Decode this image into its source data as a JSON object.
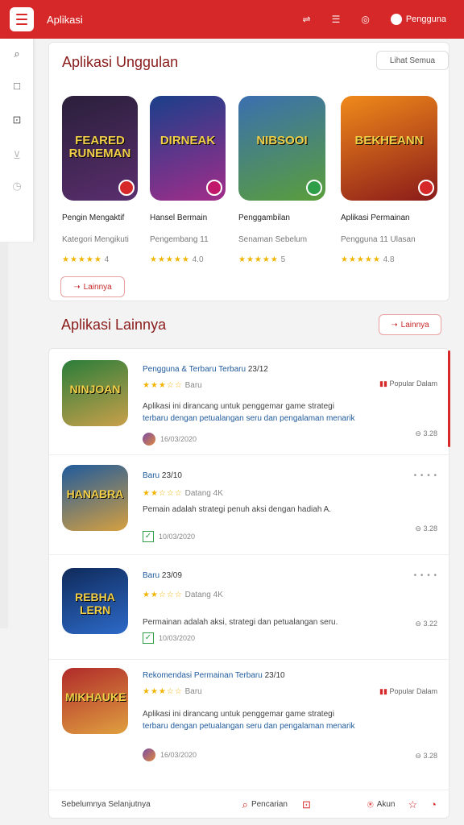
{
  "app": {
    "title": "Aplikasi"
  },
  "topbar": {
    "profile_label": "Pengguna"
  },
  "featured": {
    "title": "Aplikasi Unggulan",
    "header_button": "Lihat Semua",
    "footer_button": "Lainnya",
    "items": [
      {
        "thumb_title": "FEARED RUNEMAN",
        "name": "Pengin Mengaktif",
        "sub": "Kategori Mengikuti",
        "rating": "4",
        "grad": "#2a1f3a,#5a2e6e"
      },
      {
        "thumb_title": "DIRNEAK",
        "name": "Hansel Bermain",
        "sub": "Pengembang 11",
        "rating": "4.0",
        "grad": "#1a3f8a,#a22d8a"
      },
      {
        "thumb_title": "NIBSOOI",
        "name": "Penggambilan",
        "sub": "Senaman Sebelum",
        "rating": "5",
        "grad": "#3a6fb0,#c9a04a"
      },
      {
        "thumb_title": "BEKHEANN",
        "name": "Aplikasi Permainan",
        "sub": "Pengguna 11 Ulasan",
        "rating": "4.8",
        "grad": "#e05a1a,#8a1a1a"
      }
    ]
  },
  "list_section": {
    "title": "Aplikasi Lainnya",
    "button": "Lainnya"
  },
  "list_rows": [
    {
      "thumb_title": "NINJOAN",
      "title": "Pengguna & Terbaru Terbaru",
      "date": "23/12",
      "stars": "★★★☆☆",
      "rating_text": "Baru",
      "right": "Popular Dalam",
      "desc1": "Aplikasi ini dirancang untuk penggemar game strategi",
      "desc2": "terbaru dengan petualangan seru dan pengalaman menarik",
      "meta": "16/03/2020",
      "count": "3.28",
      "grad": "#2a7d3a,#c9a04a"
    },
    {
      "thumb_title": "HANABRA",
      "title": "Baru",
      "date": "23/10",
      "stars": "★★☆☆☆",
      "rating_text": "Datang 4K",
      "right": "",
      "desc1": "Pemain adalah strategi penuh aksi dengan hadiah A.",
      "desc2": "",
      "meta": "10/03/2020",
      "count": "3.28",
      "grad": "#1f5a9c,#d6a040"
    },
    {
      "thumb_title": "REBHA LERN",
      "title": "Baru",
      "date": "23/09",
      "stars": "★★☆☆☆",
      "rating_text": "Datang 4K",
      "right": "",
      "desc1": "Permainan adalah aksi, strategi dan petualangan seru.",
      "desc2": "",
      "meta": "10/03/2020",
      "count": "3.22",
      "grad": "#0f2a5a,#2d6ac9"
    },
    {
      "thumb_title": "MIKHAUKE",
      "title": "Rekomendasi Permainan Terbaru",
      "date": "23/10",
      "stars": "★★★☆☆",
      "rating_text": "Baru",
      "right": "Popular Dalam",
      "desc1": "Aplikasi ini dirancang untuk penggemar game strategi",
      "desc2": "terbaru dengan petualangan seru dan pengalaman menarik",
      "meta": "16/03/2020",
      "count": "3.28",
      "grad": "#b02a2a,#e0a040"
    }
  ],
  "bottom": {
    "left": "Sebelumnya Selanjutnya",
    "search": "Pencarian",
    "account": "Akun"
  },
  "colors": {
    "accent": "#d62828"
  }
}
